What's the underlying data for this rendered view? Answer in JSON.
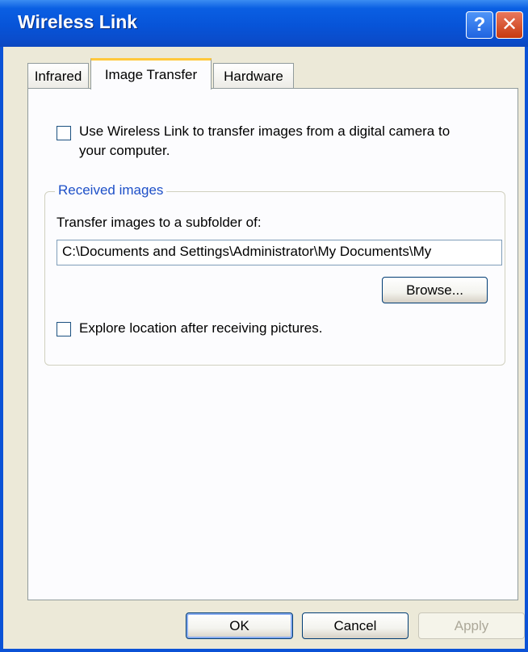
{
  "window": {
    "title": "Wireless Link",
    "help_glyph": "?",
    "close_glyph": "✕"
  },
  "tabs": [
    {
      "label": "Infrared",
      "selected": false
    },
    {
      "label": "Image Transfer",
      "selected": true
    },
    {
      "label": "Hardware",
      "selected": false
    }
  ],
  "image_transfer": {
    "use_wireless_checkbox": {
      "checked": false,
      "label_line1": "Use Wireless Link to transfer images from a digital camera to",
      "label_line2": "your computer."
    },
    "received_images": {
      "title": "Received images",
      "subfolder_label": "Transfer images to a subfolder of:",
      "path_value": "C:\\Documents and Settings\\Administrator\\My Documents\\My",
      "browse_label": "Browse...",
      "explore_checkbox": {
        "checked": false,
        "label": "Explore location after receiving pictures."
      }
    }
  },
  "buttons": {
    "ok": "OK",
    "cancel": "Cancel",
    "apply": "Apply",
    "apply_enabled": false
  },
  "colors": {
    "titlebar": "#0754d8",
    "selected_tab_accent": "#ffc83c",
    "group_title": "#1e50c8",
    "dialog_background": "#ece9d8"
  }
}
